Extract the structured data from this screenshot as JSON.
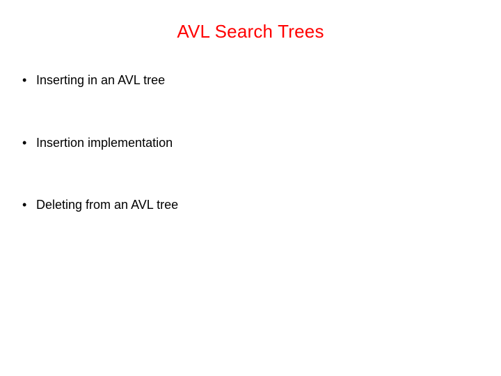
{
  "slide": {
    "title": "AVL Search Trees",
    "bullets": [
      "Inserting in an AVL tree",
      "Insertion implementation",
      "Deleting from an AVL tree"
    ]
  }
}
